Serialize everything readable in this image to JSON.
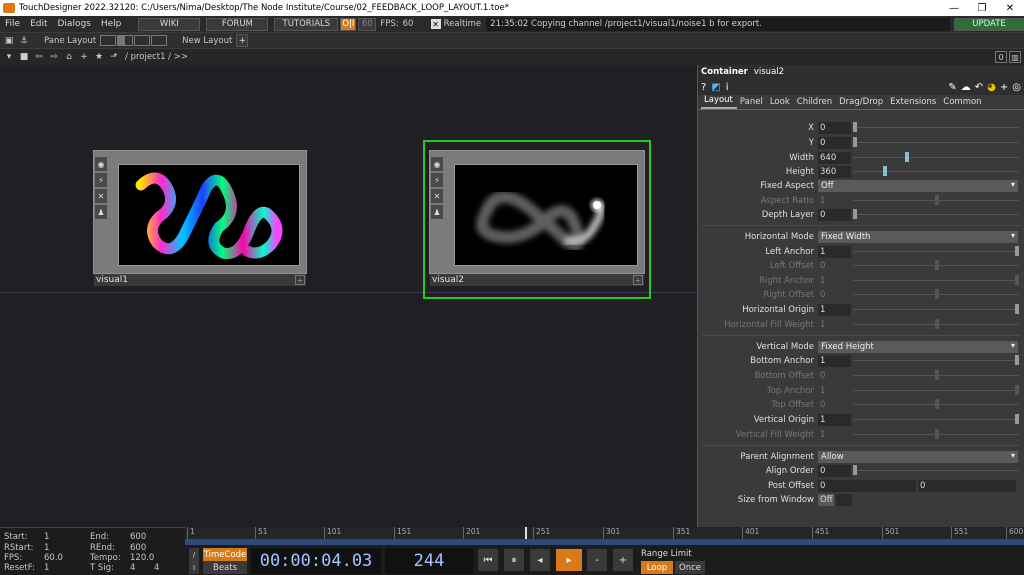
{
  "window": {
    "title": "TouchDesigner 2022.32120: C:/Users/Nima/Desktop/The Node Institute/Course/02_FEEDBACK_LOOP_LAYOUT.1.toe*",
    "minimize": "—",
    "maximize": "❐",
    "close": "✕"
  },
  "menu": {
    "items": [
      "File",
      "Edit",
      "Dialogs",
      "Help"
    ],
    "wiki": "WIKI",
    "forum": "FORUM",
    "tutorials": "TUTORIALS",
    "oi": "O|I",
    "fps_cap": "60",
    "fps_label": "FPS:",
    "fps_value": "60",
    "realtime": "Realtime",
    "status": "21:35:02 Copying channel /project1/visual1/noise1 b for export.",
    "update": "UPDATE"
  },
  "toolbar": {
    "pane_layout": "Pane Layout",
    "new_layout": "New Layout",
    "plus": "+"
  },
  "pathbar": {
    "path": "/ project1 / >>",
    "right_num": "0"
  },
  "nodes": [
    {
      "name": "visual1"
    },
    {
      "name": "visual2"
    }
  ],
  "panel": {
    "op_type": "Container",
    "op_name": "visual2",
    "tabs": [
      "Layout",
      "Panel",
      "Look",
      "Children",
      "Drag/Drop",
      "Extensions",
      "Common"
    ],
    "params": {
      "x": {
        "label": "X",
        "value": "0"
      },
      "y": {
        "label": "Y",
        "value": "0"
      },
      "width": {
        "label": "Width",
        "value": "640"
      },
      "height": {
        "label": "Height",
        "value": "360"
      },
      "fixed_aspect": {
        "label": "Fixed Aspect",
        "value": "Off"
      },
      "aspect_ratio": {
        "label": "Aspect Ratio",
        "value": "1"
      },
      "depth_layer": {
        "label": "Depth Layer",
        "value": "0"
      },
      "h_mode": {
        "label": "Horizontal Mode",
        "value": "Fixed Width"
      },
      "left_anchor": {
        "label": "Left Anchor",
        "value": "1"
      },
      "left_offset": {
        "label": "Left Offset",
        "value": "0"
      },
      "right_anchor": {
        "label": "Right Anchor",
        "value": "1"
      },
      "right_offset": {
        "label": "Right Offset",
        "value": "0"
      },
      "h_origin": {
        "label": "Horizontal Origin",
        "value": "1"
      },
      "h_fill": {
        "label": "Horizontal Fill Weight",
        "value": "1"
      },
      "v_mode": {
        "label": "Vertical Mode",
        "value": "Fixed Height"
      },
      "bottom_anchor": {
        "label": "Bottom Anchor",
        "value": "1"
      },
      "bottom_offset": {
        "label": "Bottom Offset",
        "value": "0"
      },
      "top_anchor": {
        "label": "Top Anchor",
        "value": "1"
      },
      "top_offset": {
        "label": "Top Offset",
        "value": "0"
      },
      "v_origin": {
        "label": "Vertical Origin",
        "value": "1"
      },
      "v_fill": {
        "label": "Vertical Fill Weight",
        "value": "1"
      },
      "parent_align": {
        "label": "Parent Alignment",
        "value": "Allow"
      },
      "align_order": {
        "label": "Align Order",
        "value": "0"
      },
      "post_offset": {
        "label": "Post Offset",
        "value": "0",
        "value2": "0"
      },
      "size_from_window": {
        "label": "Size from Window",
        "value": "Off"
      }
    }
  },
  "timeline": {
    "start_label": "Start:",
    "start": "1",
    "rstart_label": "RStart:",
    "rstart": "1",
    "fps_label": "FPS:",
    "fps": "60.0",
    "resetf_label": "ResetF:",
    "resetf": "1",
    "end_label": "End:",
    "end": "600",
    "rend_label": "REnd:",
    "rend": "600",
    "tempo_label": "Tempo:",
    "tempo": "120.0",
    "tsig_label": "T Sig:",
    "tsig1": "4",
    "tsig2": "4",
    "ticks": [
      "1",
      "51",
      "101",
      "151",
      "201",
      "251",
      "301",
      "351",
      "401",
      "451",
      "501",
      "551",
      "600"
    ],
    "timecode_btn": "TimeCode",
    "beats_btn": "Beats",
    "timecode": "00:00:04.03",
    "frame": "244",
    "range_limit": "Range Limit",
    "loop": "Loop",
    "once": "Once",
    "minus": "-",
    "plus": "+"
  }
}
